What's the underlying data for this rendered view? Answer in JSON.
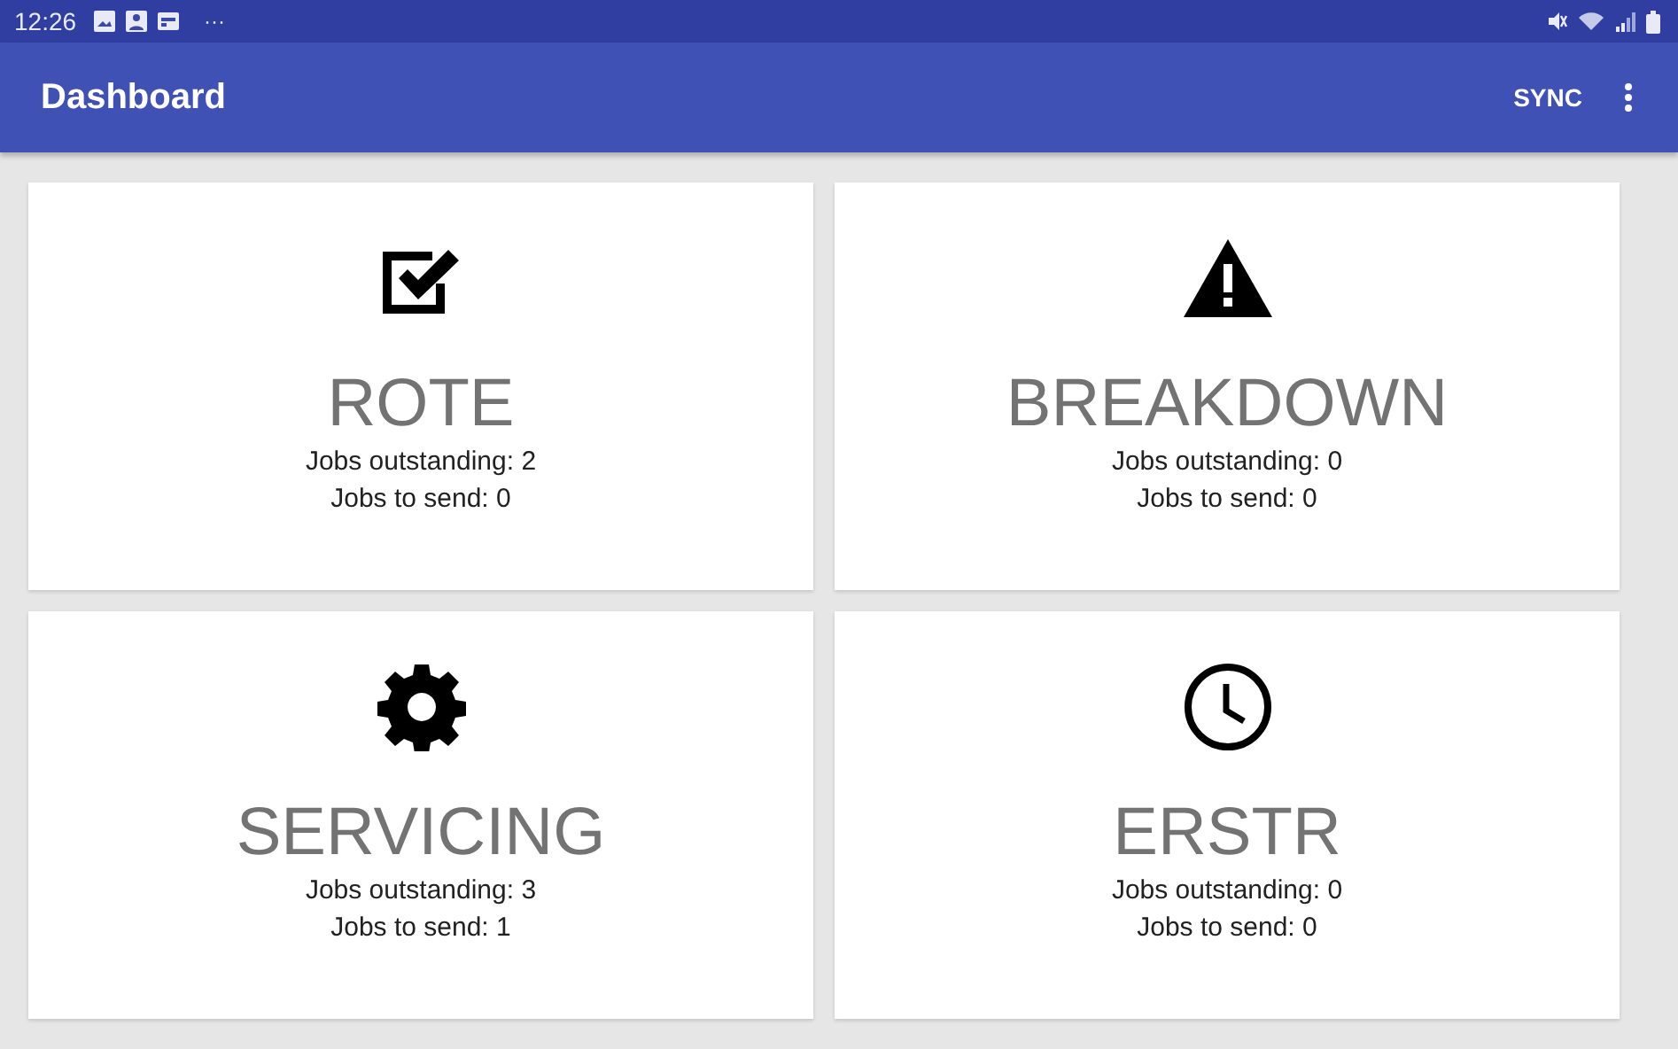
{
  "status_bar": {
    "time": "12:26",
    "more": "···"
  },
  "app_bar": {
    "title": "Dashboard",
    "action": "SYNC"
  },
  "cards": [
    {
      "kind": "checkbox",
      "title": "ROTE",
      "outstanding": "Jobs outstanding: 2",
      "to_send": "Jobs to send: 0"
    },
    {
      "kind": "warning",
      "title": "BREAKDOWN",
      "outstanding": "Jobs outstanding: 0",
      "to_send": "Jobs to send: 0"
    },
    {
      "kind": "gear",
      "title": "SERVICING",
      "outstanding": "Jobs outstanding: 3",
      "to_send": "Jobs to send: 1"
    },
    {
      "kind": "clock",
      "title": "ERSTR",
      "outstanding": "Jobs outstanding: 0",
      "to_send": "Jobs to send: 0"
    }
  ]
}
